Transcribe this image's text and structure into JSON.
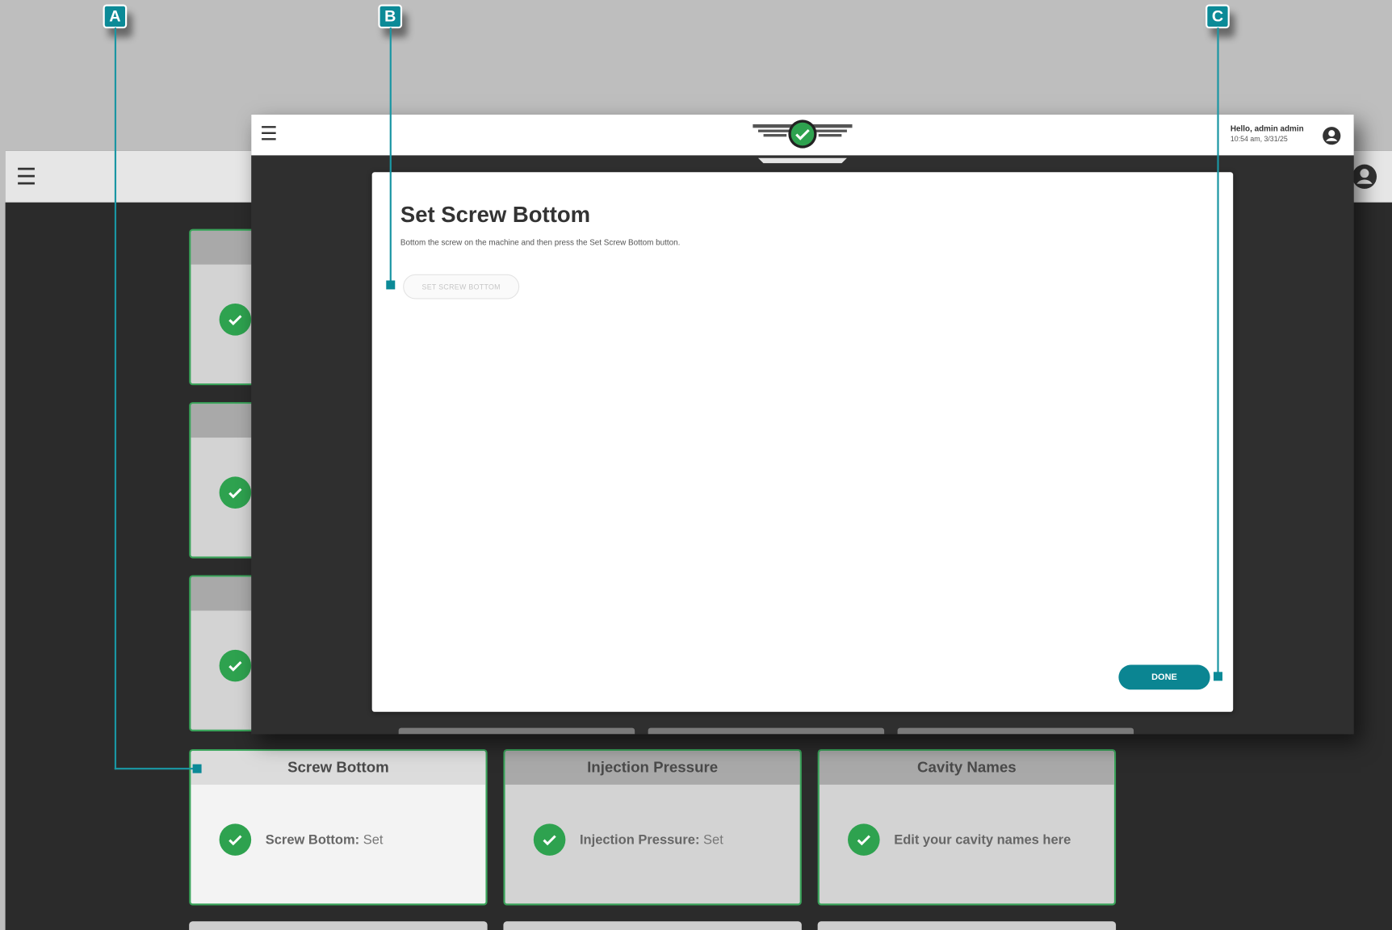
{
  "background_app": {
    "cards_row": [
      {
        "title": "Screw Bottom",
        "label": "Screw Bottom:",
        "value": "Set",
        "active": true
      },
      {
        "title": "Injection Pressure",
        "label": "Injection Pressure:",
        "value": "Set",
        "active": false
      },
      {
        "title": "Cavity Names",
        "label": "Edit your cavity names here",
        "value": "",
        "active": false
      }
    ],
    "icons": {
      "menu": "hamburger-menu-icon",
      "user": "user-account-icon",
      "check": "check-circle-icon"
    }
  },
  "window": {
    "user_greeting": "Hello, admin admin",
    "user_time": "10:54 am, 3/31/25"
  },
  "dialog": {
    "title": "Set Screw Bottom",
    "description": "Bottom the screw on the machine and then press the Set Screw Bottom button.",
    "set_button_label": "Set Screw Bottom",
    "done_button_label": "Done"
  },
  "callouts": {
    "a": "A",
    "b": "B",
    "c": "C"
  },
  "colors": {
    "accent": "#0b8a97",
    "success": "#2ea24f",
    "dark_bg": "#2b2b2b"
  }
}
